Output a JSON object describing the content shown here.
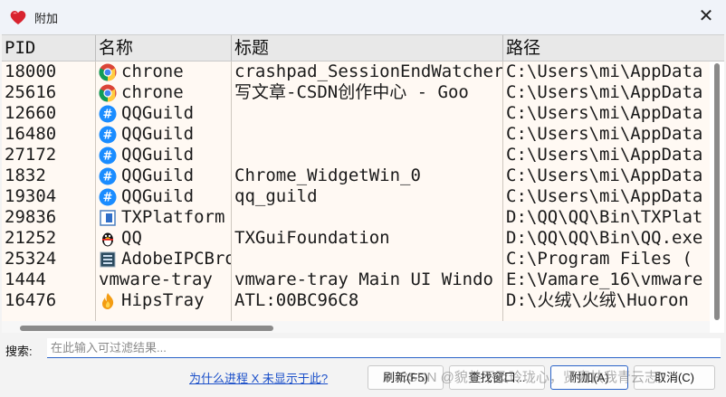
{
  "window": {
    "title": "附加",
    "close_glyph": "✕"
  },
  "table": {
    "columns": [
      "PID",
      "名称",
      "标题",
      "路径"
    ],
    "rows": [
      {
        "pid": "18000",
        "icon": "chrome-icon",
        "name": "chrone",
        "title": "crashpad_SessionEndWatcher",
        "path": "C:\\Users\\mi\\AppData"
      },
      {
        "pid": "25616",
        "icon": "chrome-icon",
        "name": "chrone",
        "title": "写文章-CSDN创作中心 - Goo",
        "path": "C:\\Users\\mi\\AppData"
      },
      {
        "pid": "12660",
        "icon": "qqguild-icon",
        "name": "QQGuild",
        "title": "",
        "path": "C:\\Users\\mi\\AppData"
      },
      {
        "pid": "16480",
        "icon": "qqguild-icon",
        "name": "QQGuild",
        "title": "",
        "path": "C:\\Users\\mi\\AppData"
      },
      {
        "pid": "27172",
        "icon": "qqguild-icon",
        "name": "QQGuild",
        "title": "",
        "path": "C:\\Users\\mi\\AppData"
      },
      {
        "pid": "1832",
        "icon": "qqguild-icon",
        "name": "QQGuild",
        "title": "Chrome_WidgetWin_0",
        "path": "C:\\Users\\mi\\AppData"
      },
      {
        "pid": "19304",
        "icon": "qqguild-icon",
        "name": "QQGuild",
        "title": "qq_guild",
        "path": "C:\\Users\\mi\\AppData"
      },
      {
        "pid": "29836",
        "icon": "txplatform-icon",
        "name": "TXPlatform",
        "title": "",
        "path": "D:\\QQ\\QQ\\Bin\\TXPlat"
      },
      {
        "pid": "21252",
        "icon": "qq-penguin-icon",
        "name": "QQ",
        "title": "TXGuiFoundation",
        "path": "D:\\QQ\\QQ\\Bin\\QQ.exe"
      },
      {
        "pid": "25324",
        "icon": "adobe-ipc-icon",
        "name": "AdobeIPCBro",
        "title": "",
        "path": "C:\\Program Files ("
      },
      {
        "pid": "1444",
        "icon": "none",
        "name": "vmware-tray",
        "title": "vmware-tray Main UI Windo",
        "path": "E:\\Vamare_16\\vmware"
      },
      {
        "pid": "16476",
        "icon": "hipstray-flame-icon",
        "name": "HipsTray",
        "title": "ATL:00BC96C8",
        "path": "D:\\火绒\\火绒\\Huoron"
      }
    ]
  },
  "search": {
    "label": "搜索:",
    "placeholder": "在此输入可过滤结果..."
  },
  "footer": {
    "help_link": "为什么进程 X 未显示于此?",
    "refresh_label": "刷新(F5)",
    "find_window_label": "查找窗口...",
    "attach_label": "附加(A)",
    "cancel_label": "取消(C)",
    "watermark": "CSDN @貌美不及玲珑心，贤妻扶我青云志"
  },
  "colors": {
    "accent": "#2a63c8",
    "row_background": "#fff9f3",
    "link": "#1a4fc9"
  }
}
